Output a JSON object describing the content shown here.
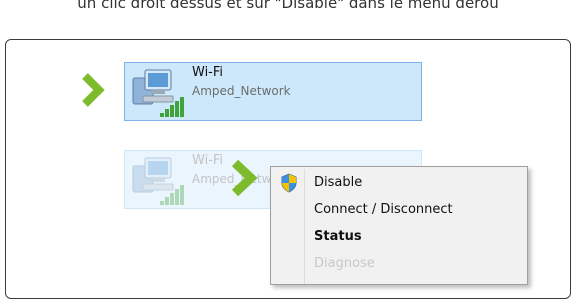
{
  "caption": "un clic droit dessus et sur \"Disable\" dans le menu dérou",
  "adapters": [
    {
      "name": "Wi-Fi",
      "network": "Amped_Network",
      "state": "selected"
    },
    {
      "name": "Wi-Fi",
      "network": "Amped_Netw",
      "state": "faded"
    }
  ],
  "context_menu": {
    "items": [
      {
        "label": "Disable",
        "icon": "shield-icon"
      },
      {
        "label": "Connect / Disconnect"
      },
      {
        "label": "Status"
      },
      {
        "label": "Diagnose"
      }
    ]
  },
  "colors": {
    "accent_arrow": "#7dbb2c",
    "selection_fill": "#cde8fb",
    "selection_border": "#7eb4ea",
    "frame_border": "#3c3c3c"
  }
}
